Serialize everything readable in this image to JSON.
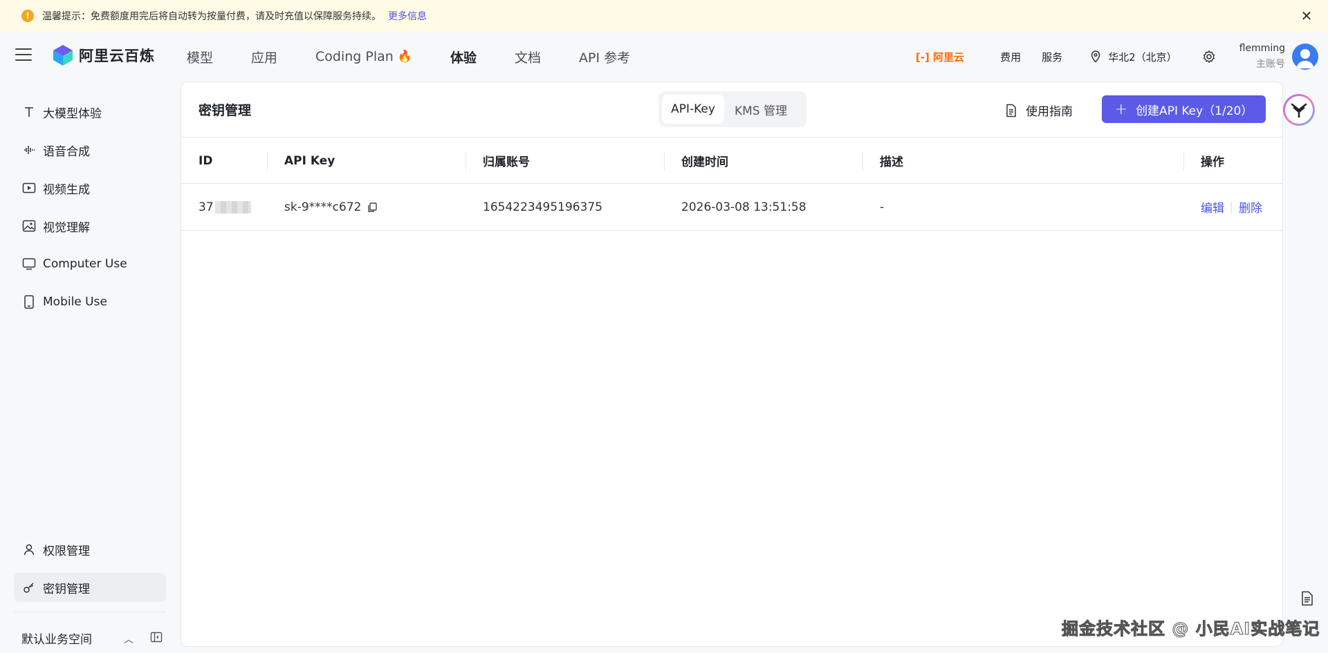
{
  "notice": {
    "icon": "!",
    "text": "温馨提示：免费额度用完后将自动转为按量付费，请及时充值以保障服务持续。",
    "link": "更多信息"
  },
  "header": {
    "logo_text": "阿里云百炼",
    "nav": [
      "模型",
      "应用",
      "Coding Plan",
      "体验",
      "文档",
      "API 参考"
    ],
    "active_nav": "体验",
    "aliyun": "[-] 阿里云",
    "links": [
      "费用",
      "服务"
    ],
    "region": "华北2（北京）",
    "user_name": "flemming",
    "user_role": "主账号"
  },
  "sidebar": {
    "items": [
      {
        "label": "大模型体验",
        "icon": "text-icon"
      },
      {
        "label": "语音合成",
        "icon": "waveform-icon"
      },
      {
        "label": "视频生成",
        "icon": "video-icon"
      },
      {
        "label": "视觉理解",
        "icon": "image-icon"
      },
      {
        "label": "Computer Use",
        "icon": "monitor-icon"
      },
      {
        "label": "Mobile Use",
        "icon": "phone-icon"
      }
    ],
    "bottom_items": [
      {
        "label": "权限管理",
        "icon": "user-icon"
      },
      {
        "label": "密钥管理",
        "icon": "key-icon"
      }
    ],
    "workspace": "默认业务空间"
  },
  "main": {
    "title": "密钥管理",
    "tabs": [
      "API-Key",
      "KMS 管理"
    ],
    "guide": "使用指南",
    "create": "创建API Key（1/20）",
    "columns": [
      "ID",
      "API Key",
      "归属账号",
      "创建时间",
      "描述",
      "操作"
    ],
    "rows": [
      {
        "id": "37",
        "api_key": "sk-9****c672",
        "account": "1654223495196375",
        "created": "2026-03-08 13:51:58",
        "desc": "-",
        "ops": [
          "编辑",
          "删除"
        ]
      }
    ]
  },
  "watermark": "掘金技术社区 @ 小民AI实战笔记"
}
